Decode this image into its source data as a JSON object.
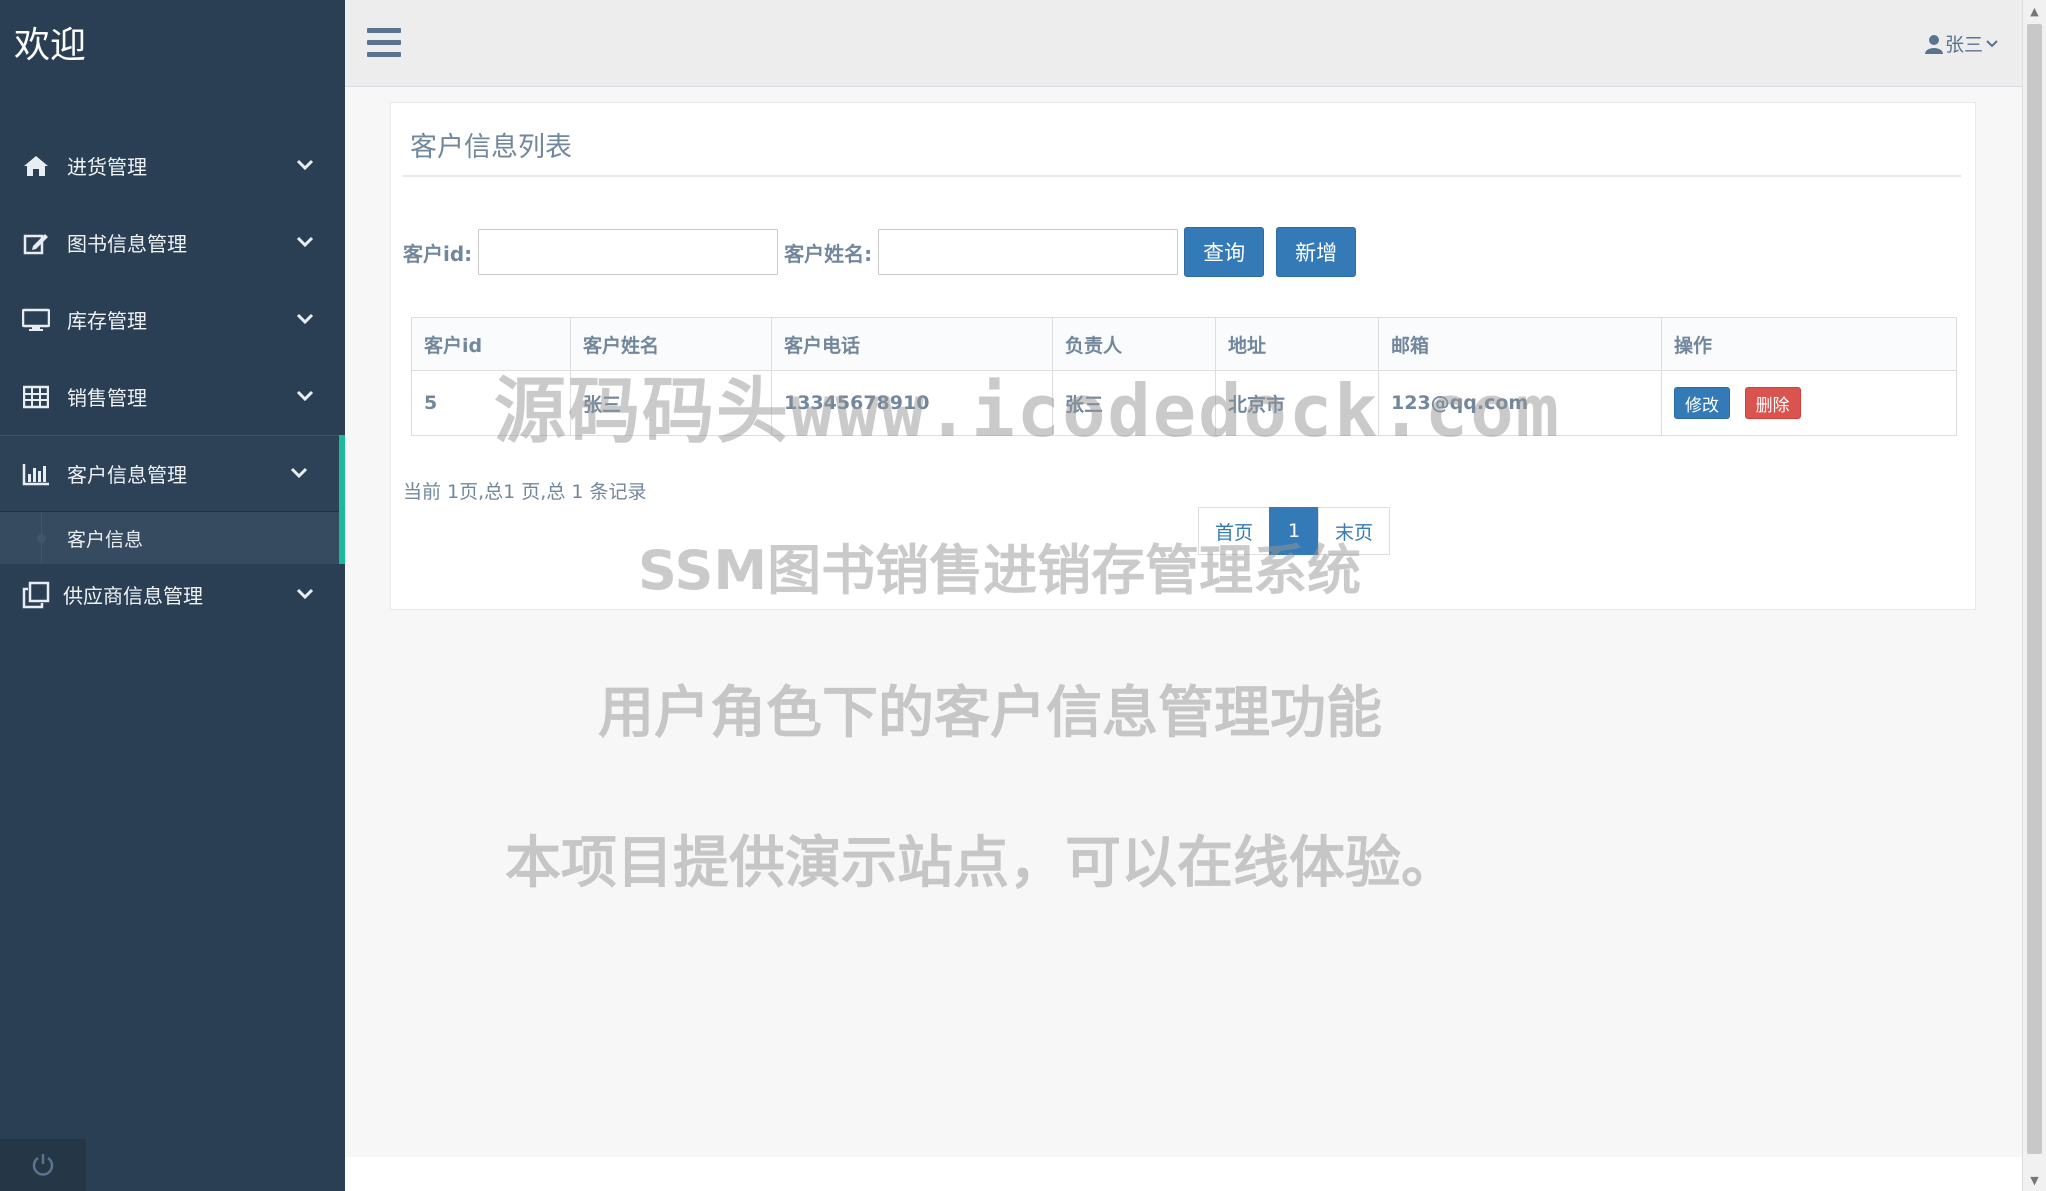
{
  "sidebar": {
    "brand": "欢迎",
    "items": [
      {
        "label": "进货管理",
        "icon": "home-icon"
      },
      {
        "label": "图书信息管理",
        "icon": "edit-icon"
      },
      {
        "label": "库存管理",
        "icon": "desktop-icon"
      },
      {
        "label": "销售管理",
        "icon": "table-icon"
      },
      {
        "label": "客户信息管理",
        "icon": "bar-chart-icon",
        "active": true
      },
      {
        "label": "供应商信息管理",
        "icon": "clone-icon"
      }
    ],
    "sub_item": "客户信息"
  },
  "topbar": {
    "user": "张三"
  },
  "panel": {
    "title": "客户信息列表",
    "search": {
      "id_label": "客户id:",
      "name_label": "客户姓名:",
      "id_value": "",
      "name_value": "",
      "query_button": "查询",
      "add_button": "新增"
    },
    "table": {
      "headers": [
        "客户id",
        "客户姓名",
        "客户电话",
        "负责人",
        "地址",
        "邮箱",
        "操作"
      ],
      "rows": [
        {
          "id": "5",
          "name": "张三",
          "phone": "13345678910",
          "owner": "张三",
          "address": "北京市",
          "email": "123@qq.com",
          "edit": "修改",
          "delete": "删除"
        }
      ]
    },
    "page_info": "当前 1页,总1 页,总 1 条记录",
    "pagination": {
      "first": "首页",
      "current": "1",
      "last": "末页"
    }
  },
  "watermark": {
    "line1": "源码码头www.icodedock.com",
    "line2": "SSM图书销售进销存管理系统",
    "line3": "用户角色下的客户信息管理功能",
    "line4": "本项目提供演示站点，可以在线体验。"
  }
}
